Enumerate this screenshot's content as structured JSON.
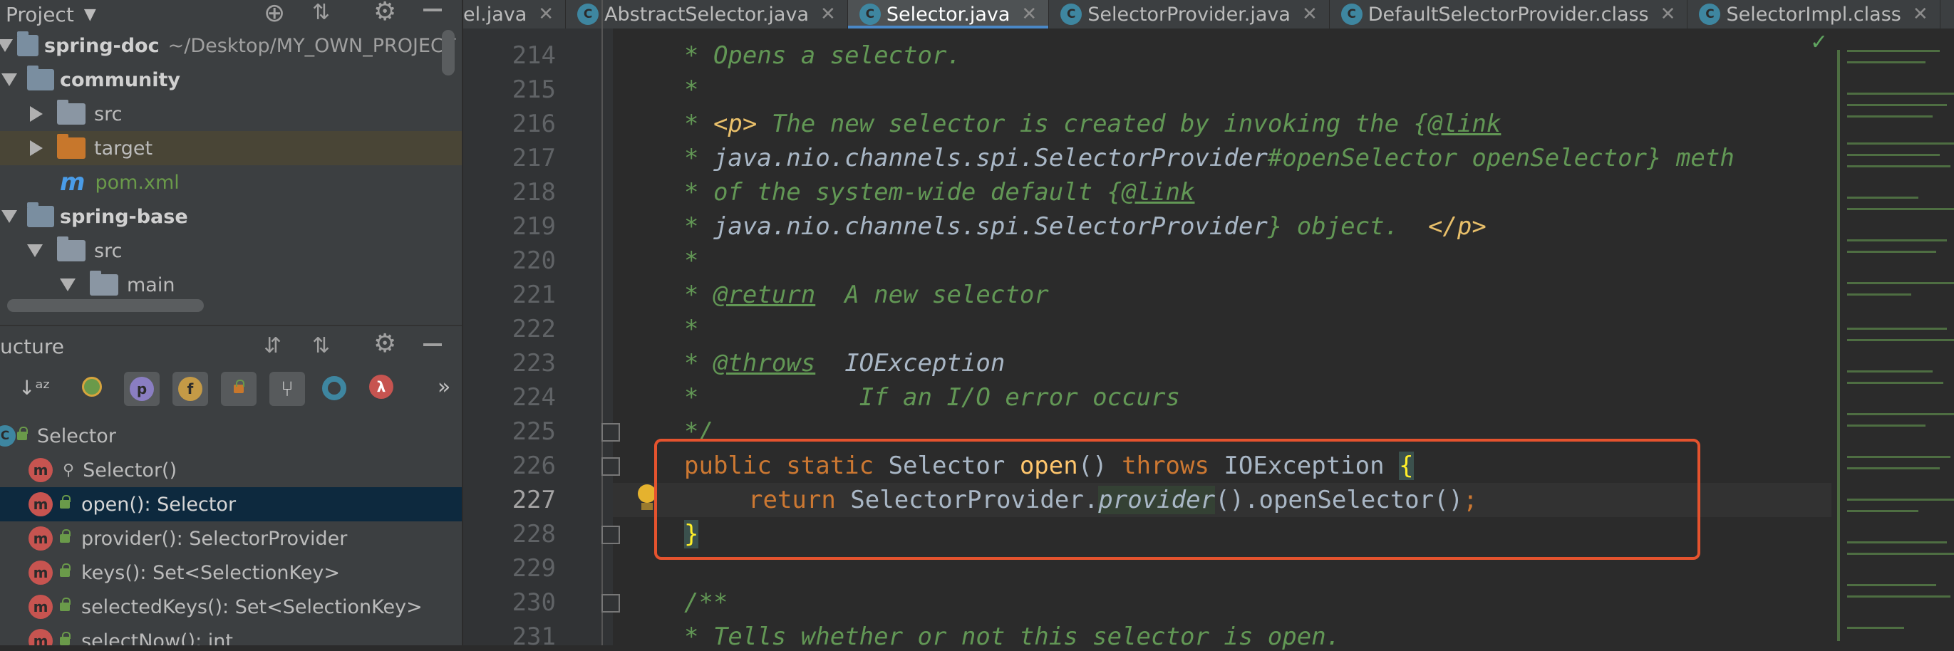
{
  "project_panel": {
    "title": "Project",
    "tree": [
      {
        "label": "spring-doc",
        "path": "~/Desktop/MY_OWN_PROJECT",
        "arrow": "down",
        "type": "module"
      },
      {
        "label": "community",
        "arrow": "down",
        "type": "module"
      },
      {
        "label": "src",
        "arrow": "right",
        "type": "folder"
      },
      {
        "label": "target",
        "arrow": "right",
        "type": "folder-excluded"
      },
      {
        "label": "pom.xml",
        "type": "maven"
      },
      {
        "label": "spring-base",
        "arrow": "down",
        "type": "module"
      },
      {
        "label": "src",
        "arrow": "down",
        "type": "folder"
      },
      {
        "label": "main",
        "arrow": "down",
        "type": "folder"
      }
    ]
  },
  "structure_panel": {
    "title": "ucture",
    "toolbar_icons": [
      "sort-alpha-icon",
      "show-inherited-icon",
      "property-icon",
      "field-icon",
      "lock-icon",
      "hierarchy-icon",
      "circle-icon",
      "lambda-icon",
      "more-icon"
    ],
    "toolbar_glyphs": {
      "p": "p",
      "f": "f",
      "lambda": "λ",
      "more": "»"
    },
    "class_name": "Selector",
    "members": [
      {
        "label": "Selector()"
      },
      {
        "label": "open(): Selector",
        "selected": true
      },
      {
        "label": "provider(): SelectorProvider"
      },
      {
        "label": "keys(): Set<SelectionKey>"
      },
      {
        "label": "selectedKeys(): Set<SelectionKey>"
      },
      {
        "label": "selectNow(): int"
      }
    ]
  },
  "tabs": [
    {
      "label": "el.java"
    },
    {
      "label": "AbstractSelector.java"
    },
    {
      "label": "Selector.java",
      "active": true
    },
    {
      "label": "SelectorProvider.java"
    },
    {
      "label": "DefaultSelectorProvider.class"
    },
    {
      "label": "SelectorImpl.class"
    }
  ],
  "editor": {
    "line_numbers": [
      "214",
      "215",
      "216",
      "217",
      "218",
      "219",
      "220",
      "221",
      "222",
      "223",
      "224",
      "225",
      "226",
      "227",
      "228",
      "229",
      "230",
      "231"
    ],
    "lines": {
      "l214": "* Opens a selector.",
      "l215": "*",
      "l216a": "* ",
      "l216b": "<p>",
      "l216c": " The new selector is created by invoking the {",
      "l216d": "@link",
      "l217a": "* ",
      "l217b": "java.nio.channels.spi.SelectorProvider",
      "l217c": "#openSelector openSelector} meth",
      "l218a": "* of the system-wide default {",
      "l218b": "@link",
      "l219a": "* ",
      "l219b": "java.nio.channels.spi.SelectorProvider",
      "l219c": "} object.  ",
      "l219d": "</p>",
      "l220": "*",
      "l221a": "* ",
      "l221b": "@return",
      "l221c": "  A new selector",
      "l222": "*",
      "l223a": "* ",
      "l223b": "@throws",
      "l223c": "  ",
      "l223d": "IOException",
      "l224": "*           If an I/O error occurs",
      "l225": "*/",
      "l226a": "public static ",
      "l226b": "Selector ",
      "l226c": "open",
      "l226d": "() ",
      "l226e": "throws ",
      "l226f": "IOException ",
      "l226g": "{",
      "l227a": "return ",
      "l227b": "SelectorProvider.",
      "l227c": "provider",
      "l227d": "().openSelector()",
      "l227e": ";",
      "l228": "}",
      "l230": "/**",
      "l231": "* Tells whether or not this selector is open."
    }
  },
  "colors": {
    "highlight_box": "#e5532e",
    "keyword": "#cc7832",
    "comment": "#629755",
    "active_tab_underline": "#4a88c7"
  }
}
